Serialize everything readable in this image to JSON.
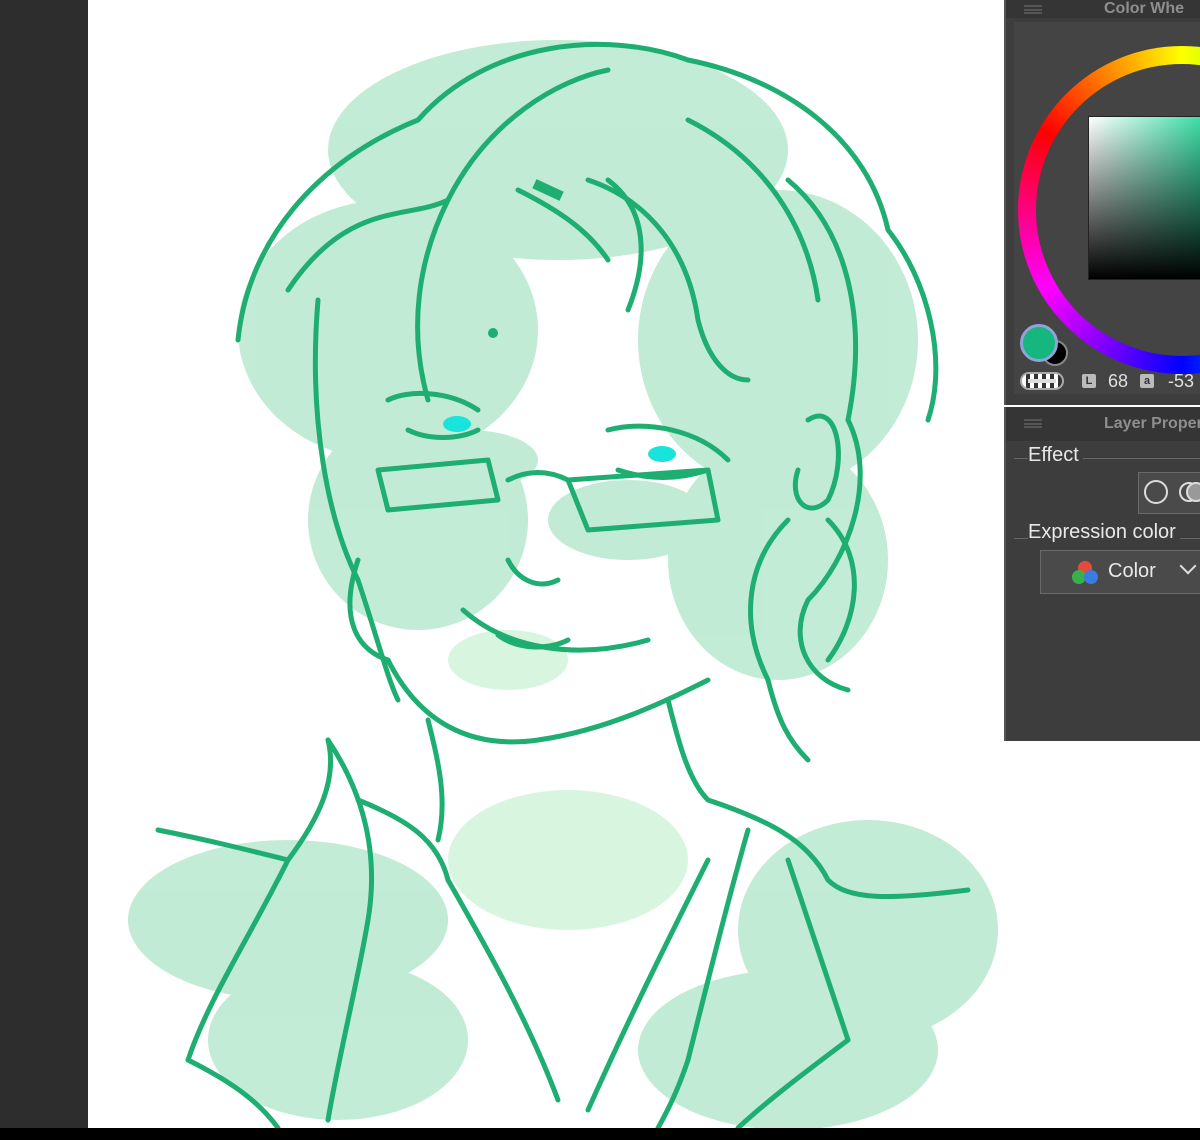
{
  "color_wheel_panel": {
    "title": "Color Whe",
    "main_color": "#16b77e",
    "sub_color": "#000000",
    "channels": [
      {
        "name": "L",
        "value": "68"
      },
      {
        "name": "a",
        "value": "-53"
      }
    ]
  },
  "layer_property_panel": {
    "title": "Layer Proper",
    "effect_label": "Effect",
    "expression_color_label": "Expression color",
    "expression_color_value": "Color"
  },
  "canvas": {
    "line_color": "#1fae71",
    "fill_color": "#8fdcb4",
    "eye_color": "#19e4dc"
  },
  "icons": [
    "menu-icon",
    "circle-outline-icon",
    "overlapping-circles-icon",
    "rgb-circles-icon",
    "chevron-down-icon"
  ]
}
